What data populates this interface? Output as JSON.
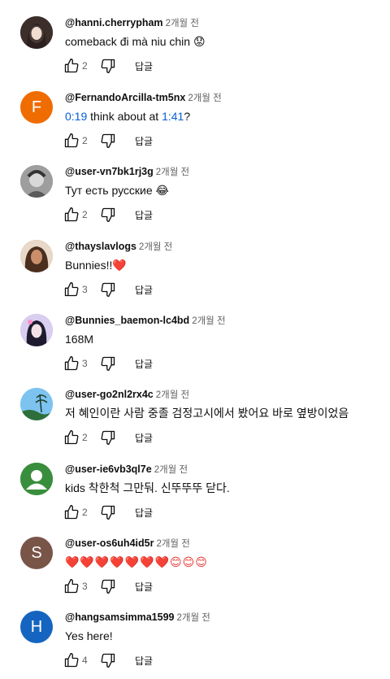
{
  "reply_label": "답글",
  "comments": [
    {
      "author": "@hanni.cherrypham",
      "time": "2개월 전",
      "text": "comeback đi mà niu chin",
      "emoji": "😟",
      "likes": "2",
      "avatar_color": "#4a3a36"
    },
    {
      "author": "@FernandoArcilla-tm5nx",
      "time": "2개월 전",
      "text_ts1": "0:19",
      "text_mid": " think about at ",
      "text_ts2": "1:41",
      "text_end": "?",
      "likes": "2",
      "avatar_letter": "F",
      "avatar_color": "#ef6c00"
    },
    {
      "author": "@user-vn7bk1rj3g",
      "time": "2개월 전",
      "text": "Тут есть русские ",
      "emoji": "😂",
      "likes": "2",
      "avatar_color": "#8a8a8a"
    },
    {
      "author": "@thayslavlogs",
      "time": "2개월 전",
      "text": "Bunnies!!",
      "emoji": "❤️",
      "likes": "3",
      "avatar_color": "#c9a27e"
    },
    {
      "author": "@Bunnies_baemon-lc4bd",
      "time": "2개월 전",
      "text": "168M",
      "likes": "3",
      "avatar_color": "#b9a8d8"
    },
    {
      "author": "@user-go2nl2rx4c",
      "time": "2개월 전",
      "text": "저 혜인이란 사람 중졸 검정고시에서 봤어요 바로 옆방이었음",
      "likes": "2",
      "avatar_color": "#6fb7e8"
    },
    {
      "author": "@user-ie6vb3ql7e",
      "time": "2개월 전",
      "text": "kids 착한척 그만둬. 신뚜뚜뚜 닫다.",
      "likes": "2",
      "avatar_color": "#388e3c"
    },
    {
      "author": "@user-os6uh4id5r",
      "time": "2개월 전",
      "text": "❤️❤️❤️❤️❤️❤️❤️😊😊😊",
      "likes": "3",
      "avatar_letter": "S",
      "avatar_color": "#795548"
    },
    {
      "author": "@hangsamsimma1599",
      "time": "2개월 전",
      "text": "Yes here!",
      "likes": "4",
      "avatar_letter": "H",
      "avatar_color": "#1565c0"
    }
  ]
}
